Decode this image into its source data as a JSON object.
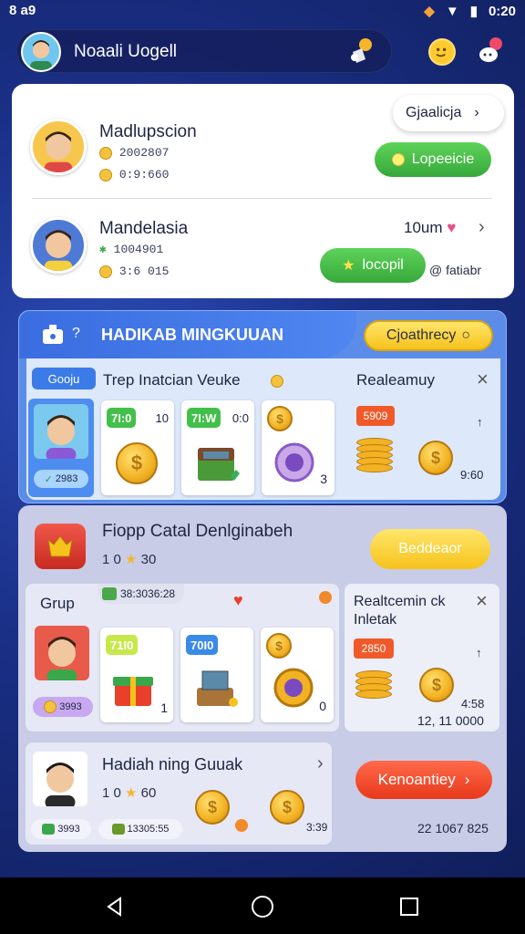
{
  "status_bar": {
    "left": "8 a9",
    "time": "0:20"
  },
  "header": {
    "title": "Noaali Uogell"
  },
  "players": [
    {
      "name": "Madlupscion",
      "stat1": "2002807",
      "stat2": "0:9:660",
      "button": "Lopeeicie",
      "top_pill": "Gjaalicja"
    },
    {
      "name": "Mandelasia",
      "stat1": "1004901",
      "stat2": "3:6 015",
      "button": "locopil",
      "right_text": "10um",
      "note": "@ fatiabr"
    }
  ],
  "section2": {
    "title": "HADIKAB MINGKUUAN",
    "action": "Cjoathrecy",
    "group_label": "Gooju",
    "subtitle": "Trep Inatcian Veuke",
    "avatar_caption": "2983",
    "tiles": [
      {
        "badge": "7I:0",
        "count": "10"
      },
      {
        "badge": "7I:W",
        "count": "0:0"
      },
      {
        "count": "3"
      }
    ],
    "right_title": "Realeamuy",
    "right_badge": "5909",
    "right_value": "9:60"
  },
  "section3": {
    "title": "Fiopp Catal Denlginabeh",
    "rating": "1 0",
    "rating_val": "30",
    "button": "Beddeaor",
    "group_label": "Grup",
    "coins_text": "38:3036:28",
    "avatar_caption": "3993",
    "tiles": [
      {
        "badge": "71I0",
        "count": "1"
      },
      {
        "badge": "70I0",
        "count": ""
      },
      {
        "count": "0"
      }
    ],
    "right_title": "Realtcemin ck Inletak",
    "right_badge": "2850",
    "right_time": "4:58",
    "right_value": "12, 11 0000"
  },
  "section4": {
    "title": "Hadiah ning Guuak",
    "rating": "1 0",
    "rating_val": "60",
    "pill1": "3993",
    "pill2": "13305:55",
    "coin_value": "3:39",
    "button": "Kenoantiey",
    "footer_value": "22 1067 825"
  }
}
